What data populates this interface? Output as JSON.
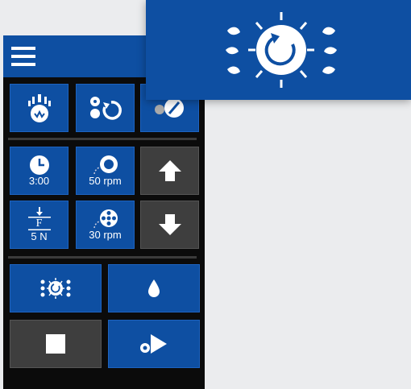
{
  "header": {
    "menu_icon": "hamburger-menu-icon"
  },
  "top_row": [
    {
      "icon": "multi-nozzle-icon"
    },
    {
      "icon": "fan-rotate-icon"
    },
    {
      "icon": "rinse-toggle-icon"
    }
  ],
  "params": {
    "time": {
      "icon": "clock-icon",
      "value": "3:00"
    },
    "speed": {
      "icon": "speed-dial-icon",
      "value": "50 rpm"
    },
    "force": {
      "icon": "force-icon",
      "symbol": "F",
      "value": "5 N"
    },
    "pump": {
      "icon": "pump-wheel-icon",
      "value": "30 rpm"
    }
  },
  "arrows": {
    "up": "arrow-up-icon",
    "down": "arrow-down-icon"
  },
  "actions": [
    {
      "icon": "spray-spin-icon"
    },
    {
      "icon": "droplet-icon"
    },
    {
      "icon": "stop-icon"
    },
    {
      "icon": "play-icon"
    }
  ],
  "zoom_preview": {
    "icon": "spray-spin-icon"
  },
  "colors": {
    "panel_blue": "#0e4fa2",
    "panel_dark": "#0b0b0b",
    "gray_button": "#3e3e3e",
    "background": "#ebecee"
  }
}
